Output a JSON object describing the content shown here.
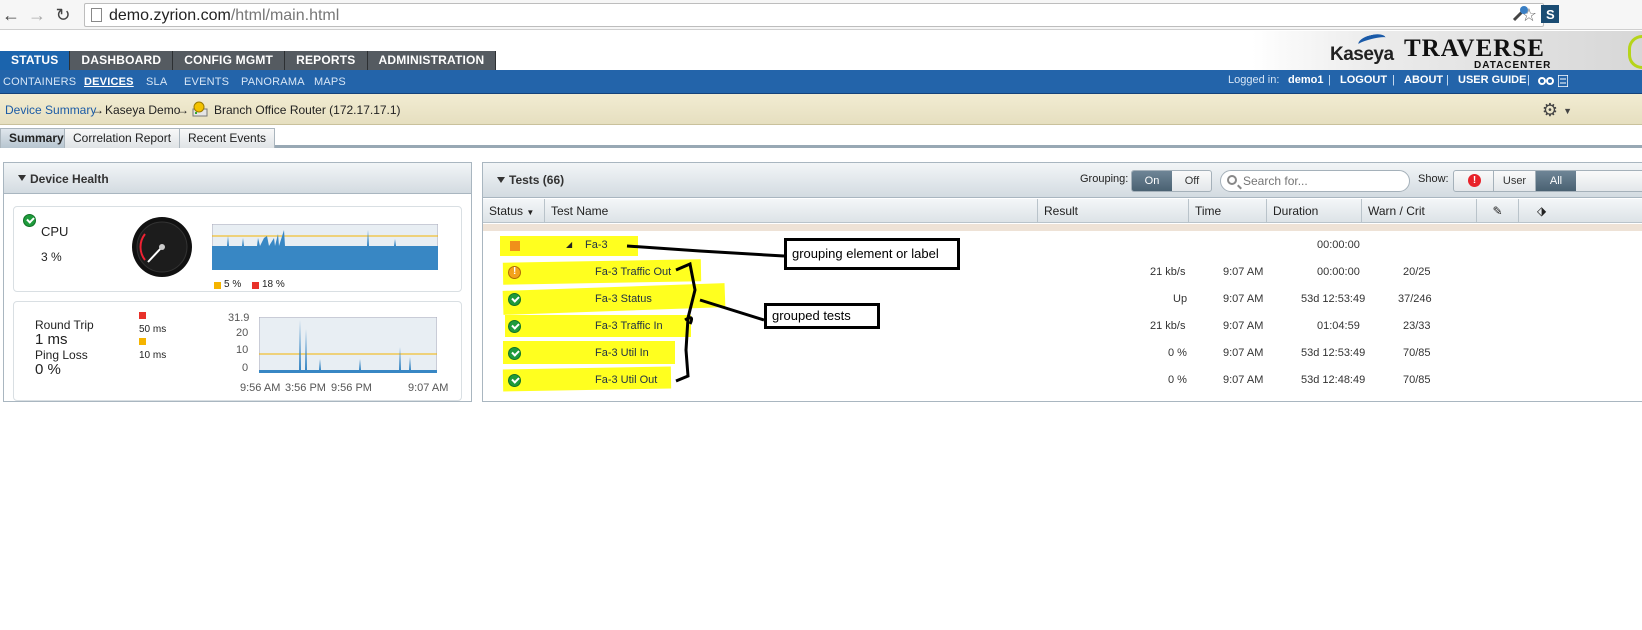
{
  "browser": {
    "url_host": "demo.zyrion.com",
    "url_path": "/html/main.html"
  },
  "top_nav": [
    "STATUS",
    "DASHBOARD",
    "CONFIG MGMT",
    "REPORTS",
    "ADMINISTRATION"
  ],
  "brand": {
    "company": "Kaseya",
    "product": "TRAVERSE",
    "edition": "DATACENTER"
  },
  "sub_nav": [
    "CONTAINERS",
    "DEVICES",
    "SLA",
    "EVENTS",
    "PANORAMA",
    "MAPS"
  ],
  "user_bar": {
    "logged_in_label": "Logged in:",
    "username": "demo1",
    "logout": "LOGOUT",
    "about": "ABOUT",
    "user_guide": "USER GUIDE"
  },
  "breadcrumb": {
    "root": "Device Summary",
    "arrow": "→",
    "container": "Kaseya Demo",
    "device": "Branch Office Router (172.17.17.1)"
  },
  "page_tabs": [
    "Summary",
    "Correlation Report",
    "Recent Events"
  ],
  "device_health": {
    "title": "Device Health",
    "cpu": {
      "label": "CPU",
      "value": "3 %",
      "legend": [
        {
          "label": "5 %",
          "color": "#f5b400"
        },
        {
          "label": "18 %",
          "color": "#e8312a"
        }
      ]
    },
    "latency": {
      "round_trip_label": "Round Trip",
      "round_trip_value": "1 ms",
      "ping_loss_label": "Ping Loss",
      "ping_loss_value": "0 %",
      "legend": [
        {
          "label": "50 ms",
          "color": "#e8312a"
        },
        {
          "label": "10 ms",
          "color": "#f5b400"
        }
      ],
      "y_ticks": [
        "31.9",
        "20",
        "10",
        "0"
      ],
      "x_ticks": [
        "9:56 AM",
        "3:56 PM",
        "9:56 PM",
        "9:07 AM"
      ]
    }
  },
  "tests": {
    "title": "Tests (66)",
    "grouping_label": "Grouping:",
    "grouping_on": "On",
    "grouping_off": "Off",
    "search_placeholder": "Search for...",
    "show_label": "Show:",
    "show_user": "User",
    "show_all": "All",
    "columns": [
      "Status",
      "Test Name",
      "Result",
      "Time",
      "Duration",
      "Warn / Crit"
    ],
    "group": {
      "name": "Fa-3",
      "duration": "00:00:00"
    },
    "rows": [
      {
        "name": "Fa-3 Traffic Out",
        "result": "21 kb/s",
        "time": "9:07 AM",
        "duration": "00:00:00",
        "warn_crit": "20/25",
        "status": "warning"
      },
      {
        "name": "Fa-3 Status",
        "result": "Up",
        "time": "9:07 AM",
        "duration": "53d 12:53:49",
        "warn_crit": "37/246",
        "status": "ok"
      },
      {
        "name": "Fa-3 Traffic In",
        "result": "21 kb/s",
        "time": "9:07 AM",
        "duration": "01:04:59",
        "warn_crit": "23/33",
        "status": "ok"
      },
      {
        "name": "Fa-3 Util In",
        "result": "0 %",
        "time": "9:07 AM",
        "duration": "53d 12:53:49",
        "warn_crit": "70/85",
        "status": "ok"
      },
      {
        "name": "Fa-3 Util Out",
        "result": "0 %",
        "time": "9:07 AM",
        "duration": "53d 12:48:49",
        "warn_crit": "70/85",
        "status": "ok"
      }
    ]
  },
  "annotations": {
    "grouping_element": "grouping element or label",
    "grouped_tests": "grouped tests"
  }
}
